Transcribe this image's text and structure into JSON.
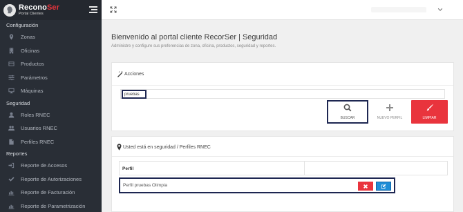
{
  "brand": {
    "name_primary": "Recono",
    "name_accent": "Ser",
    "subtitle": "Portal Clientes"
  },
  "sidebar": {
    "sections": [
      {
        "title": "Configuración",
        "items": [
          {
            "label": "Zonas",
            "icon": "map-marker-icon"
          },
          {
            "label": "Oficinas",
            "icon": "building-icon"
          },
          {
            "label": "Productos",
            "icon": "list-icon"
          },
          {
            "label": "Parámetros",
            "icon": "sliders-icon"
          },
          {
            "label": "Máquinas",
            "icon": "desktop-icon"
          }
        ]
      },
      {
        "title": "Seguridad",
        "items": [
          {
            "label": "Roles RNEC",
            "icon": "user-icon"
          },
          {
            "label": "Usuarios RNEC",
            "icon": "users-icon"
          },
          {
            "label": "Perfiles RNEC",
            "icon": "file-icon"
          }
        ]
      },
      {
        "title": "Reportes",
        "items": [
          {
            "label": "Reporte de Accesos",
            "icon": "sign-in-icon"
          },
          {
            "label": "Reporte de Autorizaciones",
            "icon": "check-icon"
          },
          {
            "label": "Reporte de Facturación",
            "icon": "chart-icon"
          },
          {
            "label": "Reporte de Parametrización",
            "icon": "chart-icon"
          }
        ]
      }
    ]
  },
  "header": {
    "title": "Bienvenido al portal cliente RecorSer | Seguridad",
    "subtitle": "Administre y configure sus preferencias de zona, oficina, productos, seguridad y reportes."
  },
  "actions": {
    "heading": "Acciones",
    "search_value": "pruebas",
    "buttons": {
      "search": "BUSCAR",
      "new_profile": "NUEVO PERFIL",
      "clear": "LIMPIAR"
    }
  },
  "profiles": {
    "breadcrumb": "Usted está en seguridad / Perfiles RNEC",
    "column_header": "Perfil",
    "rows": [
      {
        "name": "Perfil pruebas Olimpia"
      }
    ]
  },
  "colors": {
    "sidebar_bg": "#292e36",
    "accent_red": "#e9343d",
    "edit_blue": "#1f8dd6",
    "highlight_border": "#1d2651"
  }
}
